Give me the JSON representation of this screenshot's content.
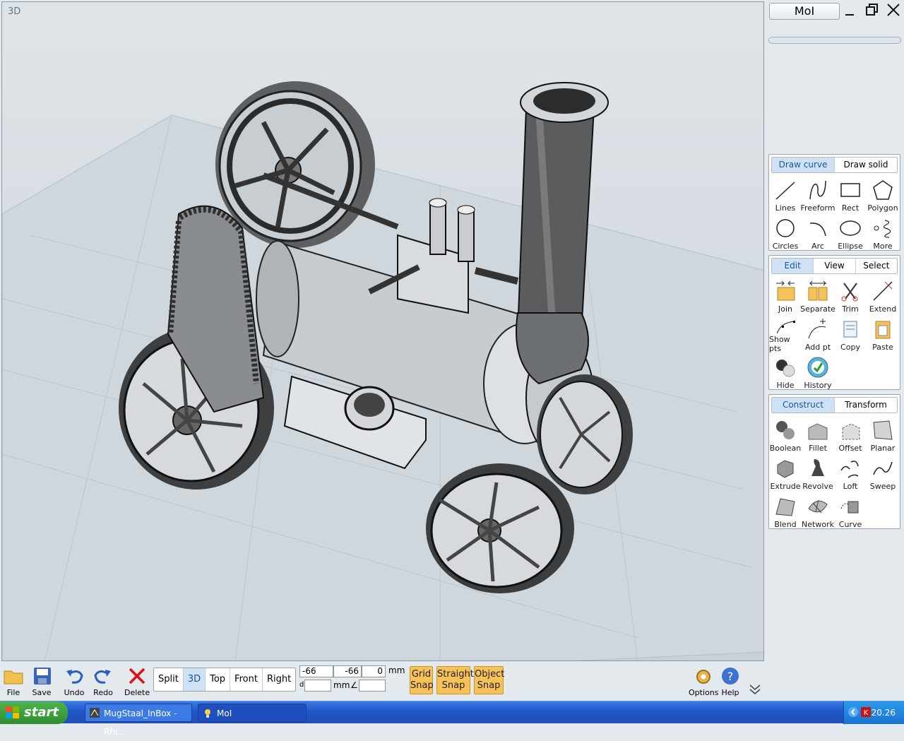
{
  "viewport": {
    "label": "3D"
  },
  "window": {
    "title": "MoI"
  },
  "panels": {
    "draw": {
      "tabs": [
        "Draw curve",
        "Draw solid"
      ],
      "tools": [
        "Lines",
        "Freeform",
        "Rect",
        "Polygon",
        "Circles",
        "Arc",
        "Ellipse",
        "More"
      ]
    },
    "edit": {
      "tabs": [
        "Edit",
        "View",
        "Select"
      ],
      "tools": [
        "Join",
        "Separate",
        "Trim",
        "Extend",
        "Show pts",
        "Add pt",
        "Copy",
        "Paste",
        "Hide",
        "History"
      ]
    },
    "construct": {
      "tabs": [
        "Construct",
        "Transform"
      ],
      "tools": [
        "Boolean",
        "Fillet",
        "Offset",
        "Planar",
        "Extrude",
        "Revolve",
        "Loft",
        "Sweep",
        "Blend",
        "Network",
        "Curve"
      ]
    }
  },
  "bottombar": {
    "file": "File",
    "save": "Save",
    "undo": "Undo",
    "redo": "Redo",
    "delete": "Delete",
    "views": [
      "Split",
      "3D",
      "Top",
      "Front",
      "Right"
    ],
    "coords": {
      "x": "-66",
      "y": "-66",
      "z": "0",
      "unit": "mm",
      "d_label": "d",
      "d_unit": "mm",
      "angle_symbol": "∠"
    },
    "snaps": {
      "grid": [
        "Grid",
        "Snap"
      ],
      "straight": [
        "Straight",
        "Snap"
      ],
      "object": [
        "Object",
        "Snap"
      ]
    },
    "options": "Options",
    "help": "Help"
  },
  "taskbar": {
    "start": "start",
    "tasks": [
      "MugStaal_InBox - Rhi...",
      "MoI"
    ],
    "clock": "20.26"
  }
}
